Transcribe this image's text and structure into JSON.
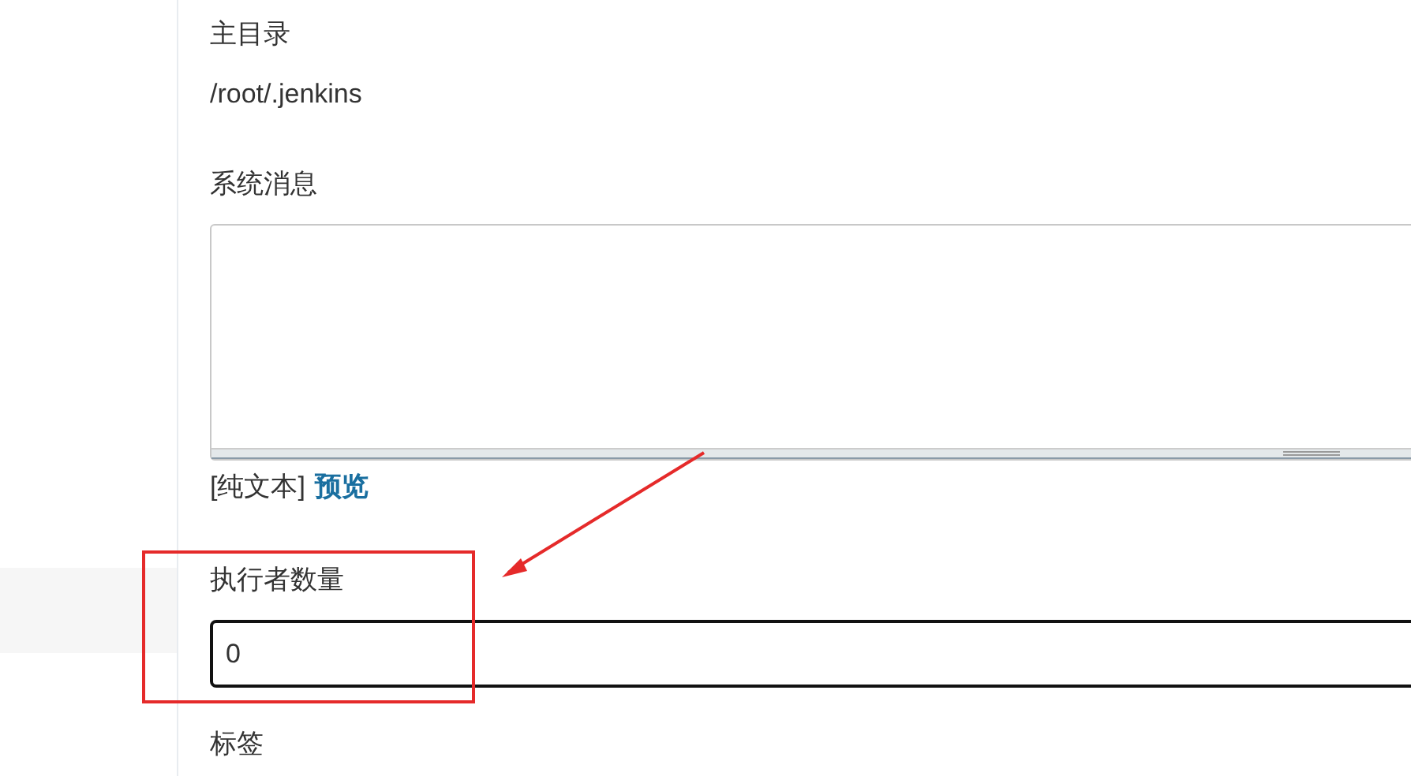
{
  "home_directory": {
    "label": "主目录",
    "value": "/root/.jenkins"
  },
  "system_message": {
    "label": "系统消息",
    "format": "[纯文本]",
    "preview_link": "预览"
  },
  "executors": {
    "label": "执行者数量",
    "value": "0"
  },
  "labels": {
    "label": "标签"
  }
}
